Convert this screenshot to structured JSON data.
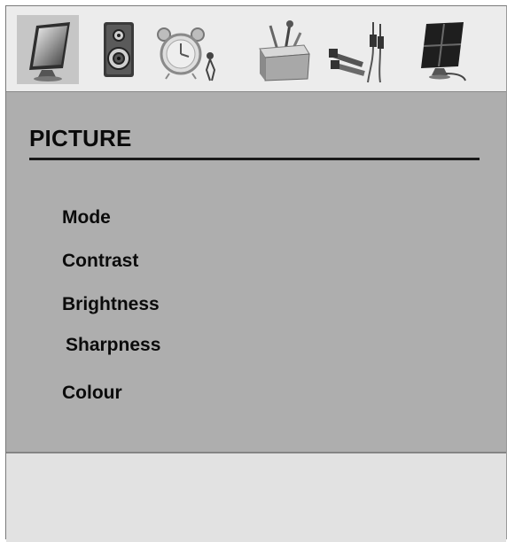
{
  "iconbar": {
    "icons": [
      {
        "name": "picture-icon",
        "selected": true
      },
      {
        "name": "sound-icon",
        "selected": false
      },
      {
        "name": "timer-icon",
        "selected": false
      },
      {
        "name": "setup-icon",
        "selected": false
      },
      {
        "name": "source-icon",
        "selected": false
      },
      {
        "name": "pc-icon",
        "selected": false
      }
    ]
  },
  "panel": {
    "title": "PICTURE",
    "items": [
      {
        "label": "Mode"
      },
      {
        "label": "Contrast"
      },
      {
        "label": "Brightness"
      },
      {
        "label": "Sharpness"
      },
      {
        "label": "Colour"
      }
    ]
  },
  "colors": {
    "panel_bg": "#aeaeae",
    "iconbar_bg": "#ececec",
    "selected_icon_bg": "#c6c6c6",
    "text": "#0b0b0b"
  }
}
